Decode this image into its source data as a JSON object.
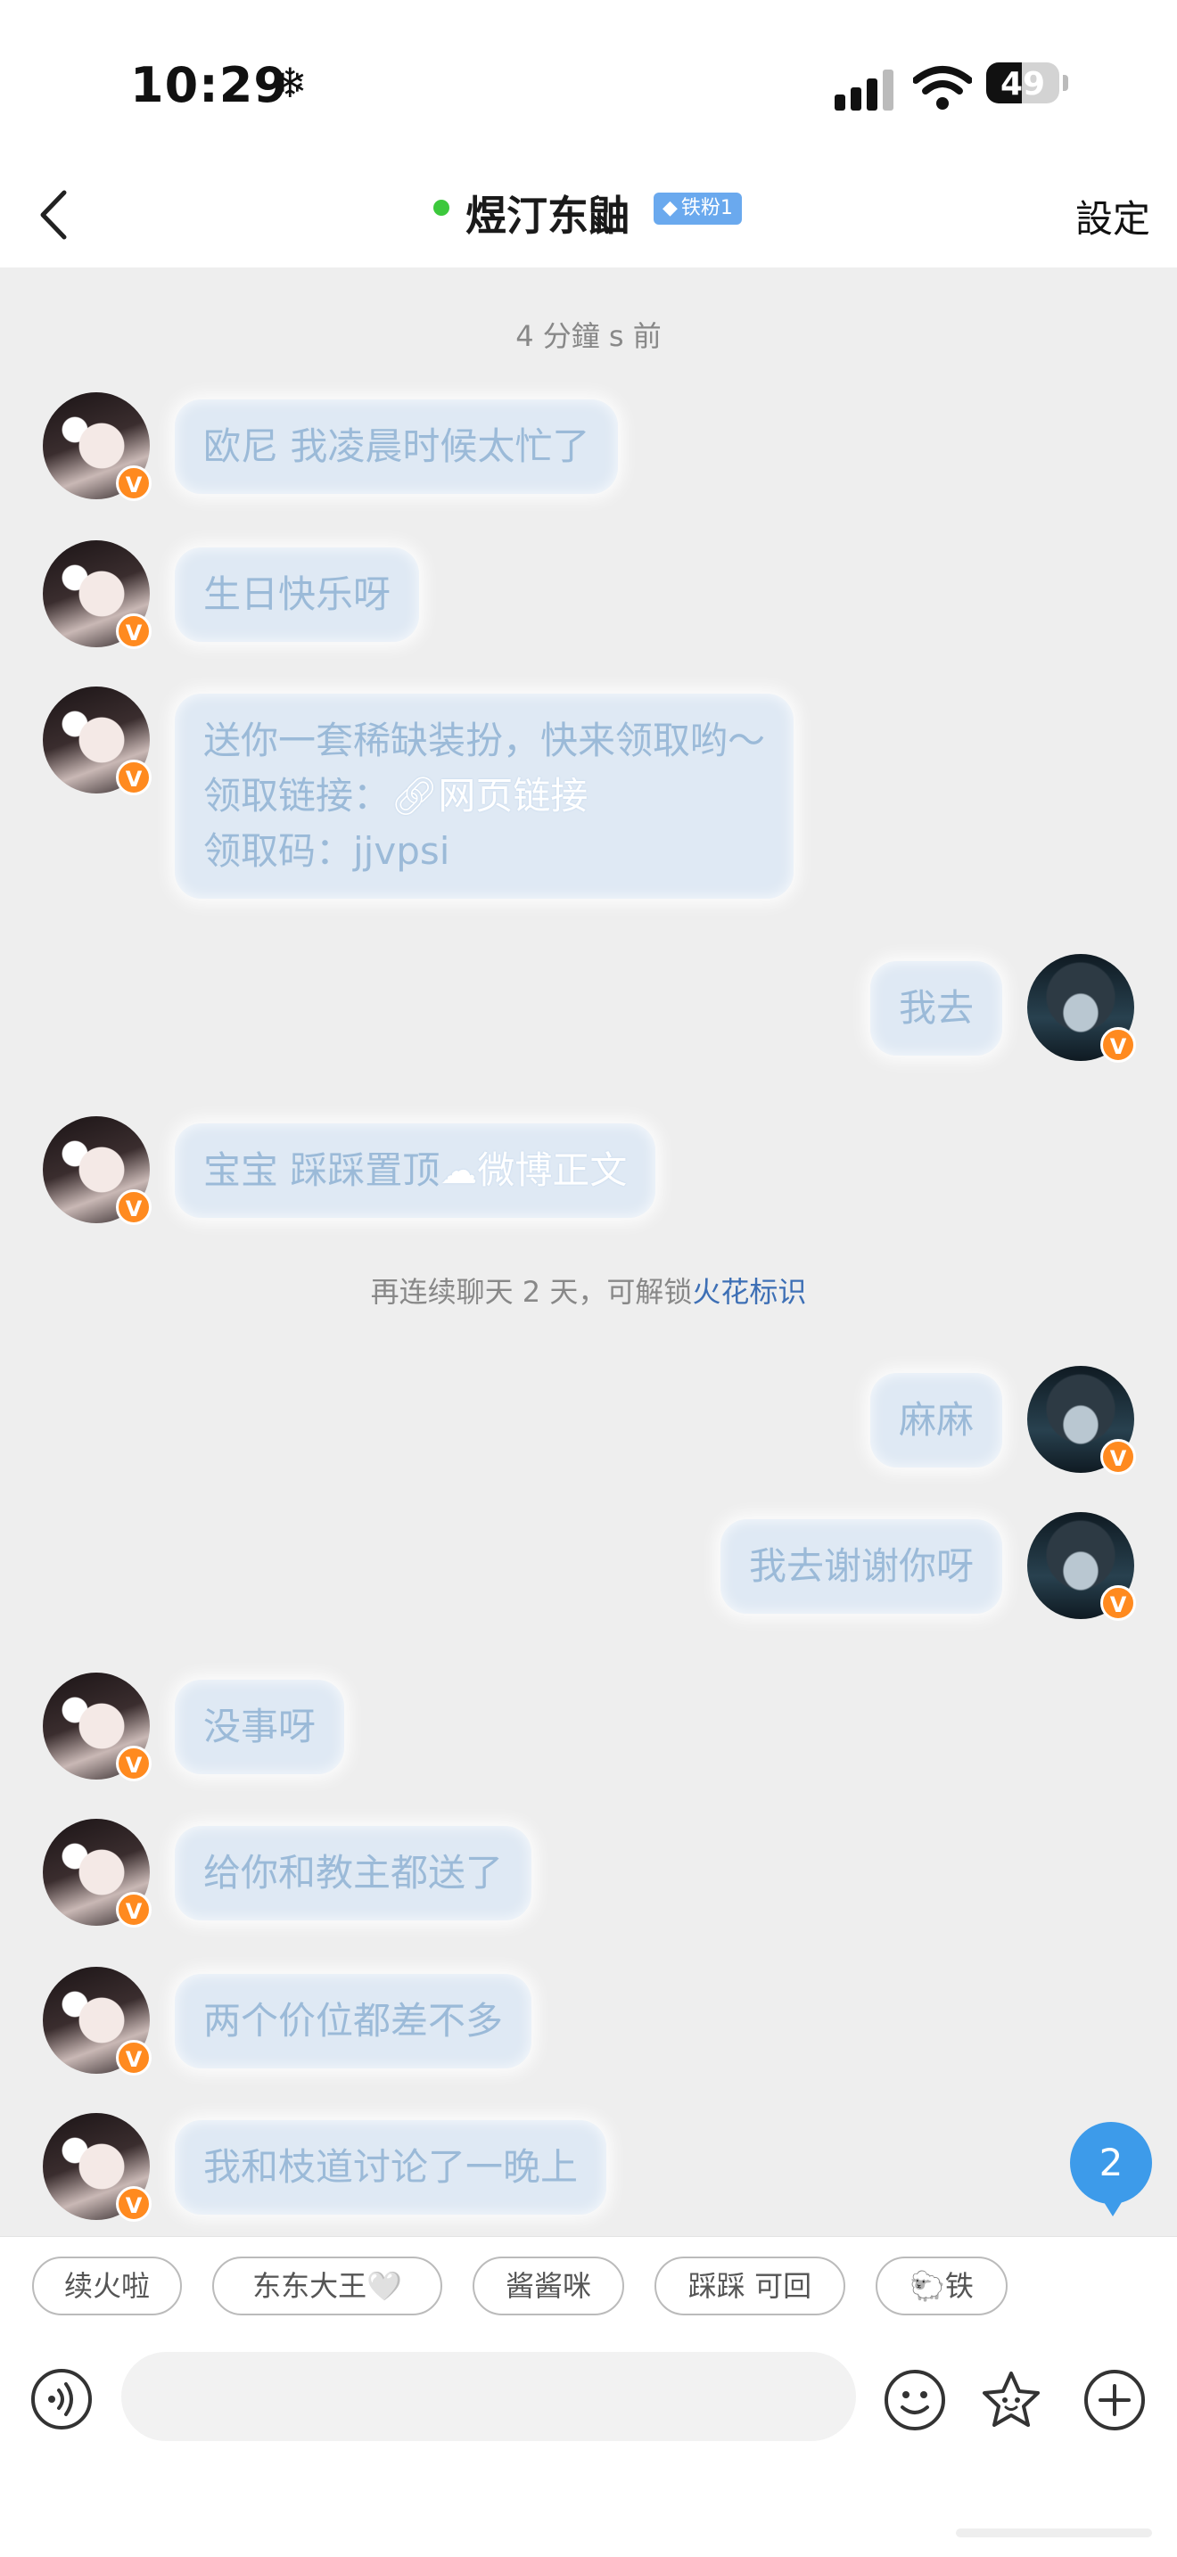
{
  "status_bar": {
    "time": "10:29",
    "battery": "49",
    "battery_level": 0.49
  },
  "nav": {
    "title": "煜汀东鼬",
    "fan_badge": "铁粉1",
    "settings_label": "設定"
  },
  "timestamp": "4 分鐘 s 前",
  "system_notice": {
    "text": "再连续聊天 2 天，可解锁",
    "highlight": "火花标识"
  },
  "messages": [
    {
      "side": "left",
      "text": "欧尼 我凌晨时候太忙了"
    },
    {
      "side": "left",
      "text": "生日快乐呀"
    },
    {
      "side": "left",
      "lines": [
        "送你一套稀缺装扮，快来领取哟～",
        "领取链接：",
        "领取码：jjvpsi"
      ],
      "link_label": "网页链接"
    },
    {
      "side": "right",
      "text": "我去"
    },
    {
      "side": "left",
      "text": "宝宝 踩踩置顶",
      "link_label": "微博正文"
    },
    {
      "side": "right",
      "text": "麻麻"
    },
    {
      "side": "right",
      "text": "我去谢谢你呀"
    },
    {
      "side": "left",
      "text": "没事呀"
    },
    {
      "side": "left",
      "text": "给你和教主都送了"
    },
    {
      "side": "left",
      "text": "两个价位都差不多"
    },
    {
      "side": "left",
      "text": "我和枝道讨论了一晚上"
    }
  ],
  "unread_count": "2",
  "avatar_badge": "V",
  "quick_replies": [
    "续火啦",
    "东东大王🤍",
    "酱酱咪",
    "踩踩 可回",
    "🐑铁"
  ],
  "input": {
    "placeholder": ""
  },
  "colors": {
    "bubble": "#dfe9f4",
    "bubble_text": "#9bbad8",
    "accent": "#3d9bea",
    "badge_orange": "#ff8a1f",
    "online": "#3cc83c"
  }
}
